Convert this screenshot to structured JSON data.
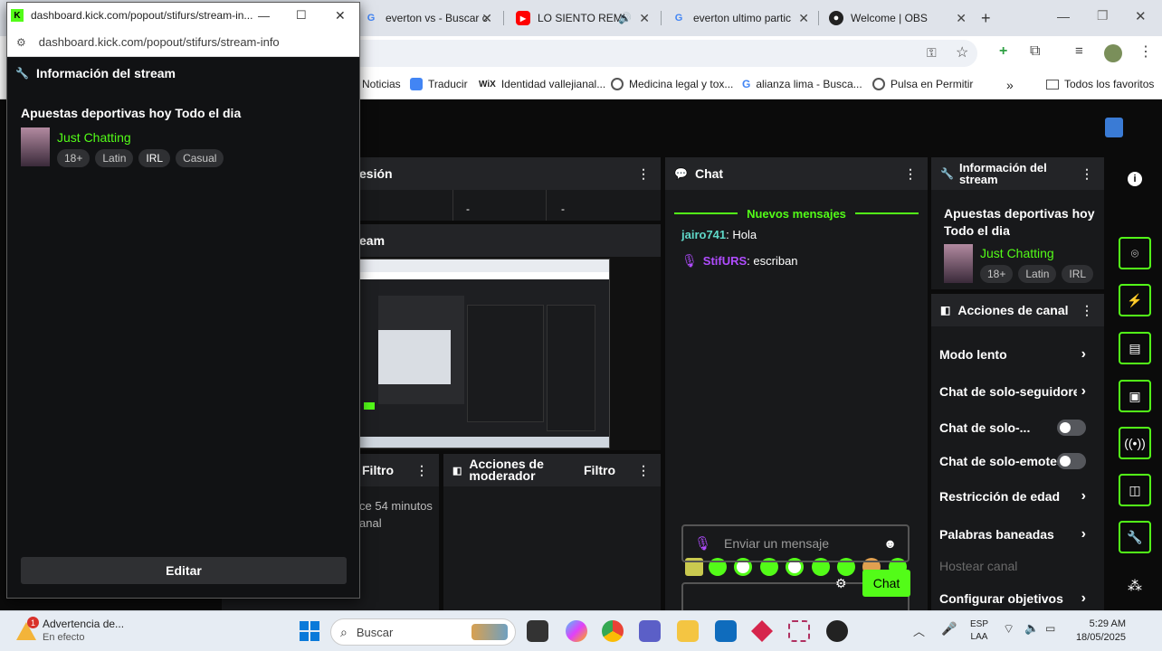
{
  "browser": {
    "tabs": [
      {
        "label": "everton vs - Buscar c"
      },
      {
        "label": "LO SIENTO REMI"
      },
      {
        "label": "everton ultimo partic"
      },
      {
        "label": "Welcome | OBS"
      }
    ],
    "bookmarks": [
      "Noticias",
      "Traducir",
      "Identidad vallejianal...",
      "Medicina legal y tox...",
      "alianza lima - Busca...",
      "Pulsa en Permitir",
      "Todos los favoritos"
    ]
  },
  "popup": {
    "title": "dashboard.kick.com/popout/stifurs/stream-in...",
    "url": "dashboard.kick.com/popout/stifurs/stream-info",
    "header": "Información del stream",
    "stream_title": "Apuestas deportivas hoy Todo el dia",
    "category": "Just Chatting",
    "tags": [
      "18+",
      "Latin",
      "IRL",
      "Casual"
    ],
    "edit_label": "Editar"
  },
  "dashboard": {
    "session_header": "esión",
    "stream_header": "eam",
    "filter_left": "Filtro",
    "activity_line1": "ce 54 minutos",
    "activity_line2": "anal",
    "mod_actions_title": "Acciones de moderador",
    "mod_filter": "Filtro",
    "cell_dashes": [
      "-",
      "-"
    ],
    "chat": {
      "header": "Chat",
      "new_messages": "Nuevos mensajes",
      "messages": [
        {
          "user": "jairo741",
          "text": ": Hola",
          "color": "#5fd8c8"
        },
        {
          "user": "StifURS",
          "text": ": escriban",
          "color": "#b04cff"
        }
      ],
      "input_placeholder": "Enviar un mensaje",
      "send_label": "Chat"
    },
    "info": {
      "header_line1": "Información del",
      "header_line2": "stream",
      "title_line1": "Apuestas deportivas hoy",
      "title_line2": "Todo el dia",
      "category": "Just Chatting",
      "tags": [
        "18+",
        "Latin",
        "IRL"
      ]
    },
    "channel_actions": {
      "header": "Acciones de canal",
      "items": [
        "Modo lento",
        "Chat de solo-seguidores",
        "Chat de solo-...",
        "Chat de solo-emotes",
        "Restricción de edad",
        "Palabras baneadas",
        "Hostear canal",
        "Configurar objetivos"
      ]
    }
  },
  "taskbar": {
    "notification_title": "Advertencia de...",
    "notification_sub": "En efecto",
    "notification_count": "1",
    "search_label": "Buscar",
    "lang_line1": "ESP",
    "lang_line2": "LAA",
    "time": "5:29 AM",
    "date": "18/05/2025"
  },
  "colors": {
    "kick_green": "#53fc18",
    "panel_bg": "#18191b",
    "panel_header": "#232427"
  }
}
